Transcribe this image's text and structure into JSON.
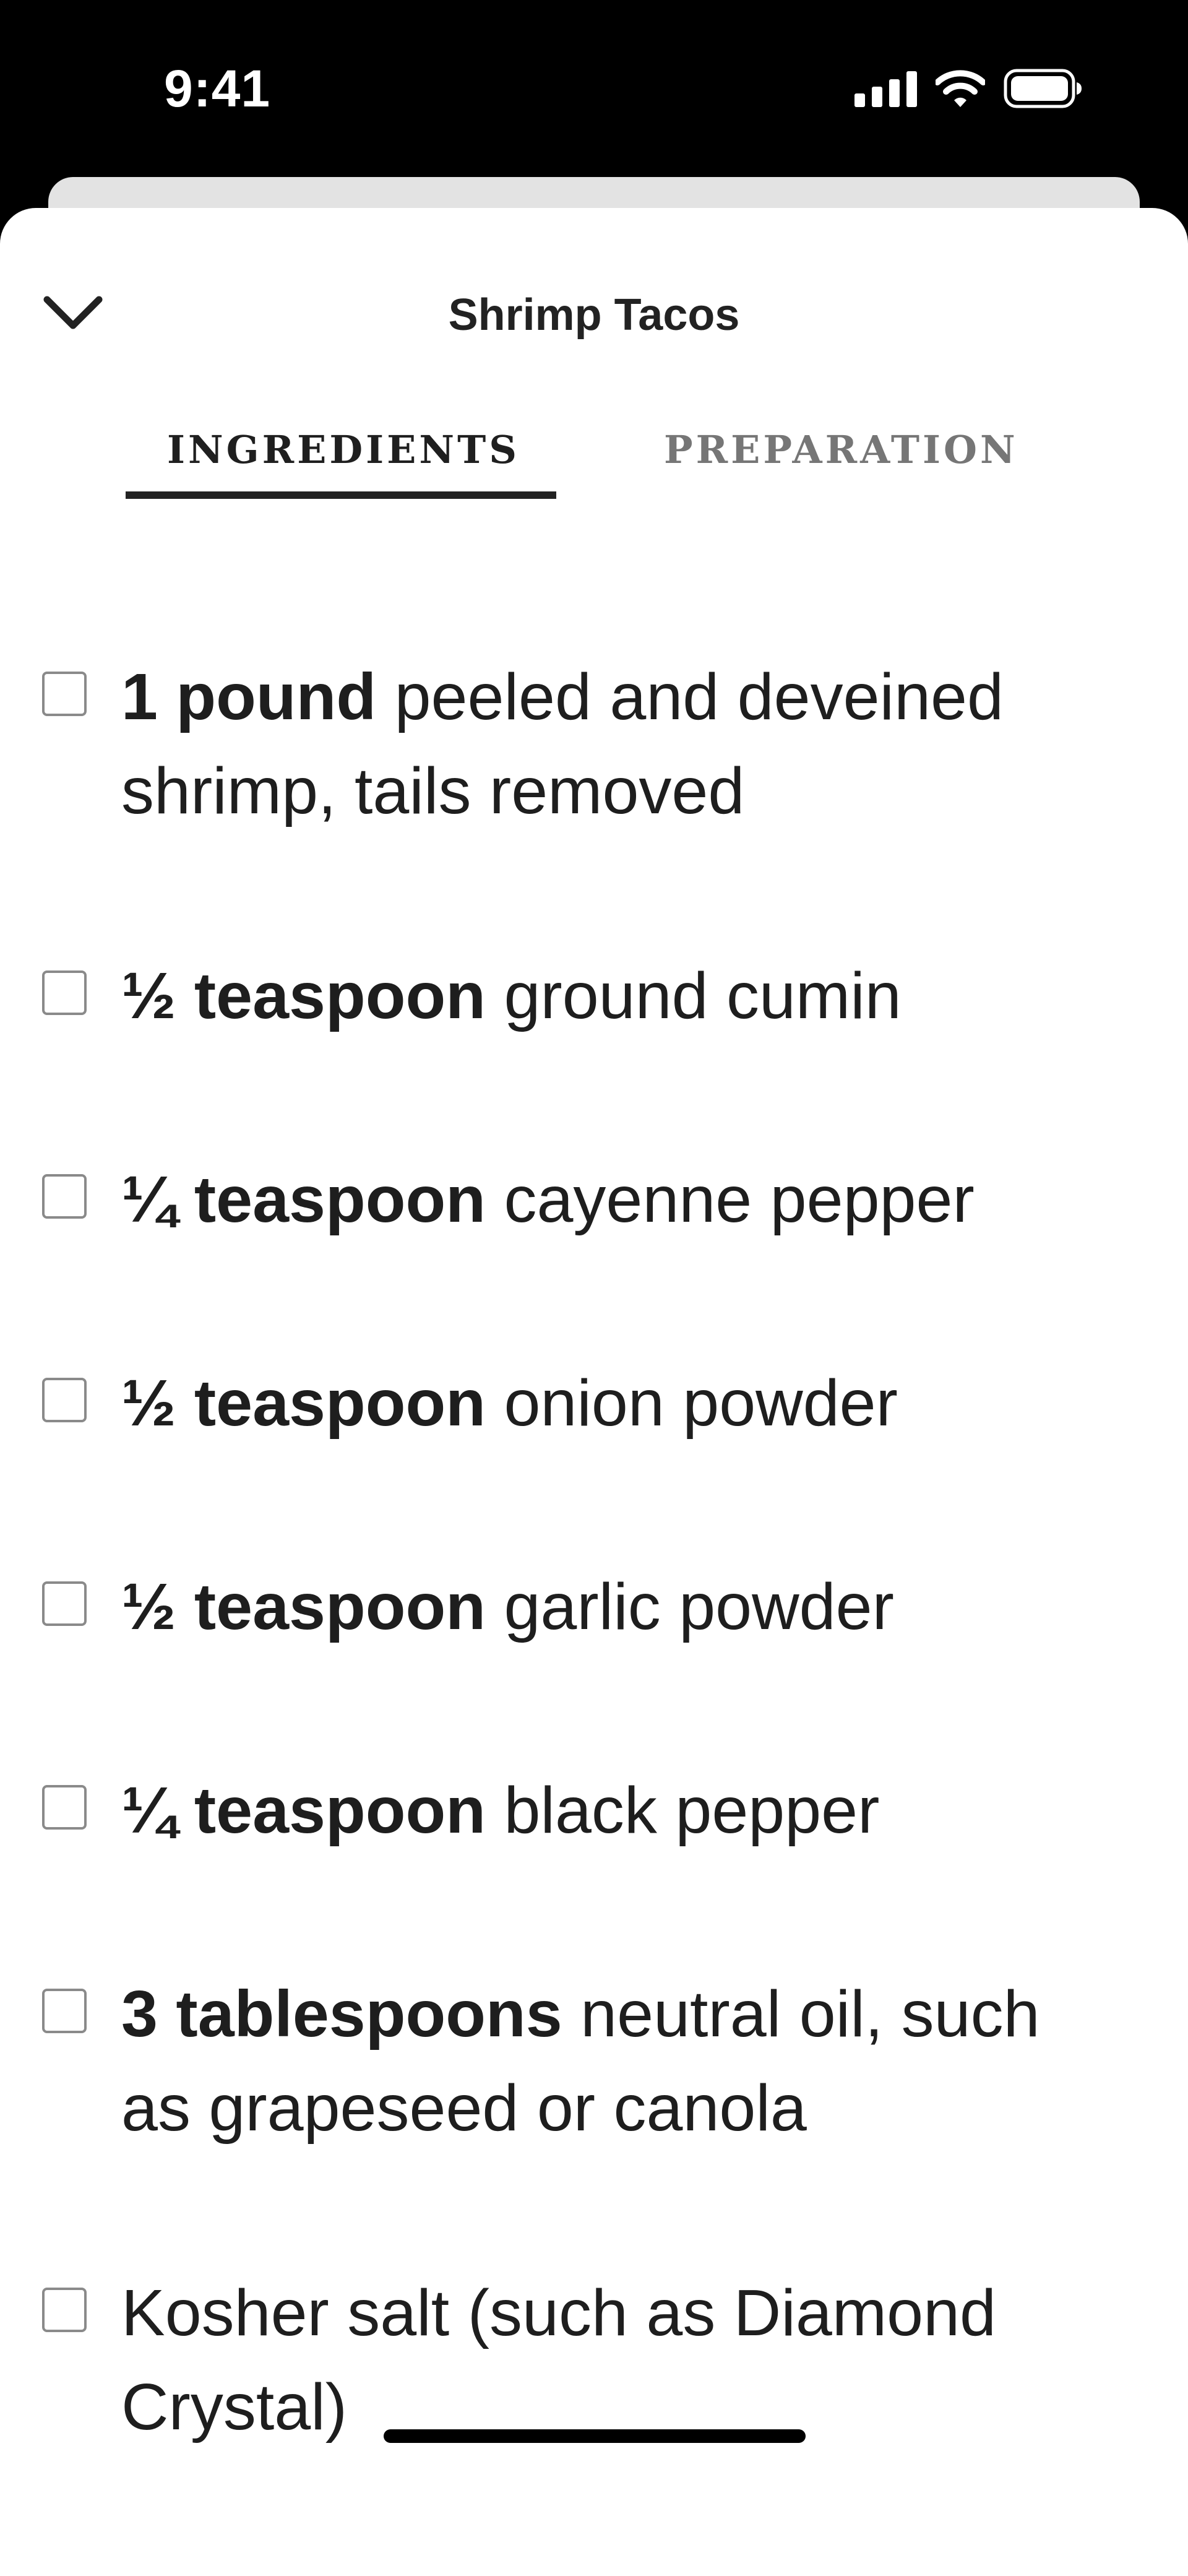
{
  "status_bar": {
    "time": "9:41"
  },
  "header": {
    "title": "Shrimp Tacos"
  },
  "tabs": [
    {
      "label": "INGREDIENTS",
      "selected": true
    },
    {
      "label": "PREPARATION",
      "selected": false
    }
  ],
  "ingredients": [
    {
      "quantity": "1 pound",
      "item": " peeled and deveined shrimp, tails removed",
      "checked": false
    },
    {
      "quantity": "½ teaspoon",
      "item": " ground cumin",
      "checked": false
    },
    {
      "quantity": "¼ teaspoon",
      "item": " cayenne pepper",
      "checked": false
    },
    {
      "quantity": "½ teaspoon",
      "item": " onion powder",
      "checked": false
    },
    {
      "quantity": "½ teaspoon",
      "item": " garlic powder",
      "checked": false
    },
    {
      "quantity": "¼ teaspoon",
      "item": " black pepper",
      "checked": false
    },
    {
      "quantity": "3 tablespoons",
      "item": " neutral oil, such as grapeseed or canola",
      "checked": false
    },
    {
      "quantity": "",
      "item": "Kosher salt (such as Diamond Crystal)",
      "checked": false
    }
  ],
  "colors": {
    "status_bar_bg": "#000000",
    "sheet_bg": "#ffffff",
    "text": "#1e1e1e",
    "inactive_tab": "#767676"
  },
  "icons": [
    "cellular-signal-icon",
    "wifi-icon",
    "battery-icon",
    "chevron-down-icon"
  ]
}
